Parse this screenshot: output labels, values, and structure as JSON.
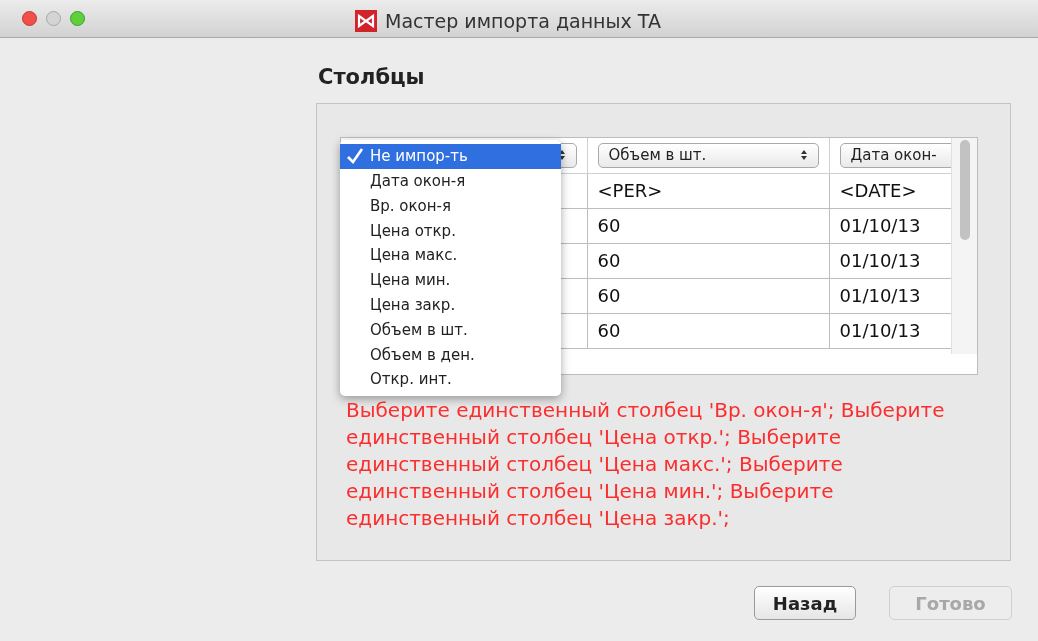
{
  "window": {
    "title": "Мастер импорта данных TA"
  },
  "heading": "Столбцы",
  "table": {
    "columns": [
      {},
      {
        "popup": "Объем в шт."
      },
      {
        "popup": "Дата окон-"
      }
    ],
    "rows": [
      [
        null,
        "<PER>",
        "<DATE>"
      ],
      [
        null,
        "60",
        "01/10/13"
      ],
      [
        null,
        "60",
        "01/10/13"
      ],
      [
        null,
        "60",
        "01/10/13"
      ],
      [
        null,
        "60",
        "01/10/13"
      ]
    ]
  },
  "menu": {
    "items": [
      {
        "label": "Не импор-ть",
        "selected": true
      },
      {
        "label": "Дата окон-я",
        "selected": false
      },
      {
        "label": "Вр. окон-я",
        "selected": false
      },
      {
        "label": "Цена откр.",
        "selected": false
      },
      {
        "label": "Цена макс.",
        "selected": false
      },
      {
        "label": "Цена мин.",
        "selected": false
      },
      {
        "label": "Цена закр.",
        "selected": false
      },
      {
        "label": "Объем в шт.",
        "selected": false
      },
      {
        "label": "Объем в ден.",
        "selected": false
      },
      {
        "label": "Откр. инт.",
        "selected": false
      }
    ]
  },
  "error": "Выберите единственный столбец 'Вр. окон-я'; Выберите единственный столбец 'Цена откр.'; Выберите единственный столбец 'Цена макс.'; Выберите единственный столбец 'Цена мин.'; Выберите единственный столбец 'Цена закр.';",
  "buttons": [
    {
      "label": "Назад",
      "disabled": false
    },
    {
      "label": "Готово",
      "disabled": true
    }
  ]
}
